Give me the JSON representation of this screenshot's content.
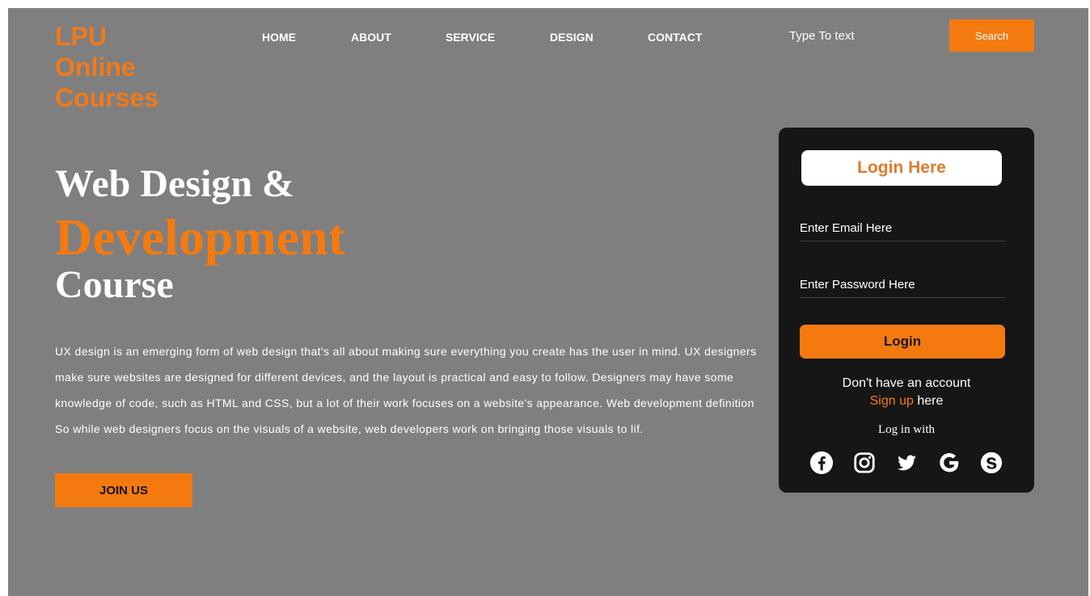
{
  "logo": {
    "line1": "LPU",
    "line2": "Online",
    "line3": "Courses"
  },
  "nav": {
    "items": [
      "HOME",
      "ABOUT",
      "SERVICE",
      "DESIGN",
      "CONTACT"
    ]
  },
  "search": {
    "text": "Type To text",
    "button": "Search"
  },
  "hero": {
    "line1": "Web Design &",
    "line2": "Development",
    "line3": "Course",
    "description": "UX design is an emerging form of web design that's all about making sure everything you create has the user in mind. UX designers make sure websites are designed for different devices, and the layout is practical and easy to follow. Designers may have some knowledge of code, such as HTML and CSS, but a lot of their work focuses on a website's appearance. Web development definition So while web designers focus on the visuals of a website, web developers work on bringing those visuals to lif.",
    "join_label": "JOIN US"
  },
  "login": {
    "title": "Login Here",
    "email_placeholder": "Enter Email Here",
    "password_placeholder": "Enter Password Here",
    "button": "Login",
    "no_account": "Don't have an account",
    "signup_link": "Sign up",
    "signup_tail": " here",
    "login_with": "Log in with",
    "socials": [
      "facebook-icon",
      "instagram-icon",
      "twitter-icon",
      "google-icon",
      "skype-icon"
    ]
  },
  "colors": {
    "accent": "#f47a10",
    "background": "#7f7f7f",
    "card": "#161616"
  }
}
